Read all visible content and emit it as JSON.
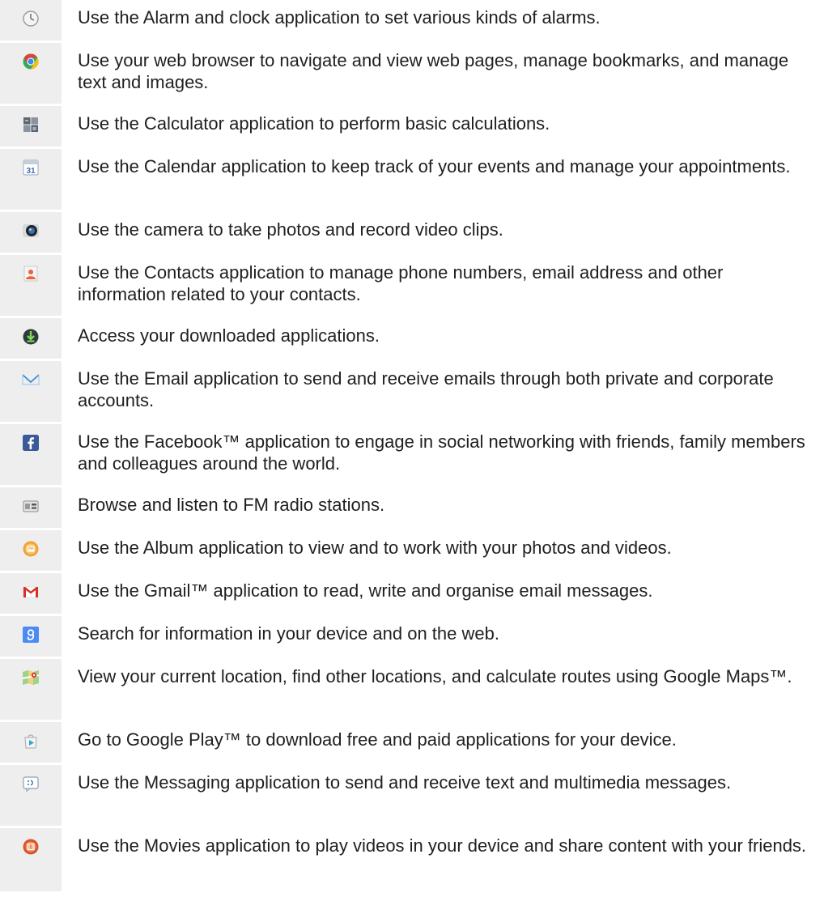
{
  "items": [
    {
      "icon": "alarm-clock-icon",
      "text": "Use the Alarm and clock application to set various kinds of alarms."
    },
    {
      "icon": "browser-icon",
      "text": "Use your web browser to navigate and view web pages, manage bookmarks, and manage text and images."
    },
    {
      "icon": "calculator-icon",
      "text": "Use the Calculator application to perform basic calculations."
    },
    {
      "icon": "calendar-icon",
      "icon_label": "31",
      "text": "Use the Calendar application to keep track of your events and manage your appointments."
    },
    {
      "icon": "camera-icon",
      "text": "Use the camera to take photos and record video clips."
    },
    {
      "icon": "contacts-icon",
      "text": "Use the Contacts application to manage phone numbers, email address and other information related to your contacts."
    },
    {
      "icon": "download-icon",
      "text": "Access your downloaded applications."
    },
    {
      "icon": "email-icon",
      "text": "Use the Email application to send and receive emails through both private and corporate accounts."
    },
    {
      "icon": "facebook-icon",
      "text": "Use the Facebook™ application to engage in social networking with friends, family members and colleagues around the world."
    },
    {
      "icon": "fm-radio-icon",
      "text": "Browse and listen to FM radio stations."
    },
    {
      "icon": "album-icon",
      "text": "Use the Album application to view and to work with your photos and videos."
    },
    {
      "icon": "gmail-icon",
      "text": "Use the Gmail™ application to read, write and organise email messages."
    },
    {
      "icon": "google-search-icon",
      "text": "Search for information in your device and on the web."
    },
    {
      "icon": "maps-icon",
      "text": "View your current location, find other locations, and calculate routes using Google Maps™."
    },
    {
      "icon": "play-store-icon",
      "text": "Go to Google Play™ to download free and paid applications for your device."
    },
    {
      "icon": "messaging-icon",
      "text": "Use the Messaging application to send and receive text and multimedia messages."
    },
    {
      "icon": "movies-icon",
      "text": "Use the Movies application to play videos in your device and share content with your friends."
    }
  ]
}
